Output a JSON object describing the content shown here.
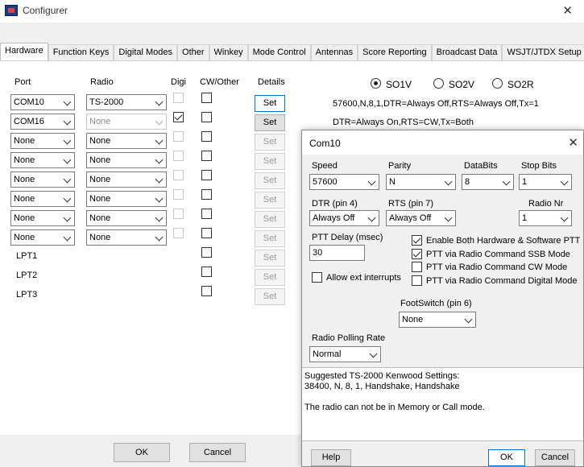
{
  "window": {
    "title": "Configurer"
  },
  "tabs": [
    "Hardware",
    "Function Keys",
    "Digital Modes",
    "Other",
    "Winkey",
    "Mode Control",
    "Antennas",
    "Score Reporting",
    "Broadcast Data",
    "WSJT/JTDX Setup"
  ],
  "headers": {
    "port": "Port",
    "radio": "Radio",
    "digi": "Digi",
    "cw": "CW/Other",
    "details": "Details"
  },
  "rows": [
    {
      "port": "COM10",
      "radio": "TS-2000",
      "radio_disabled": false,
      "digi_checked": false,
      "digi_disabled": true,
      "cw_checked": false,
      "set": "Set",
      "set_enabled": true,
      "set_focus": true
    },
    {
      "port": "COM16",
      "radio": "None",
      "radio_disabled": true,
      "digi_checked": true,
      "digi_disabled": false,
      "cw_checked": false,
      "set": "Set",
      "set_enabled": true,
      "set_focus": false
    },
    {
      "port": "None",
      "radio": "None",
      "radio_disabled": false,
      "digi_checked": false,
      "digi_disabled": true,
      "cw_checked": false,
      "set": "Set",
      "set_enabled": false,
      "set_focus": false
    },
    {
      "port": "None",
      "radio": "None",
      "radio_disabled": false,
      "digi_checked": false,
      "digi_disabled": true,
      "cw_checked": false,
      "set": "Set",
      "set_enabled": false,
      "set_focus": false
    },
    {
      "port": "None",
      "radio": "None",
      "radio_disabled": false,
      "digi_checked": false,
      "digi_disabled": true,
      "cw_checked": false,
      "set": "Set",
      "set_enabled": false,
      "set_focus": false
    },
    {
      "port": "None",
      "radio": "None",
      "radio_disabled": false,
      "digi_checked": false,
      "digi_disabled": true,
      "cw_checked": false,
      "set": "Set",
      "set_enabled": false,
      "set_focus": false
    },
    {
      "port": "None",
      "radio": "None",
      "radio_disabled": false,
      "digi_checked": false,
      "digi_disabled": true,
      "cw_checked": false,
      "set": "Set",
      "set_enabled": false,
      "set_focus": false
    },
    {
      "port": "None",
      "radio": "None",
      "radio_disabled": false,
      "digi_checked": false,
      "digi_disabled": true,
      "cw_checked": false,
      "set": "Set",
      "set_enabled": false,
      "set_focus": false
    }
  ],
  "lpt": [
    {
      "label": "LPT1",
      "set": "Set"
    },
    {
      "label": "LPT2",
      "set": "Set"
    },
    {
      "label": "LPT3",
      "set": "Set"
    }
  ],
  "so_radios": {
    "so1v": "SO1V",
    "so2v": "SO2V",
    "so2r": "SO2R",
    "selected": "SO1V"
  },
  "status_lines": [
    "57600,N,8,1,DTR=Always Off,RTS=Always Off,Tx=1",
    "DTR=Always On,RTS=CW,Tx=Both"
  ],
  "buttons": {
    "ok": "OK",
    "cancel": "Cancel"
  },
  "dialog": {
    "title": "Com10",
    "speed": {
      "label": "Speed",
      "value": "57600"
    },
    "parity": {
      "label": "Parity",
      "value": "N"
    },
    "databits": {
      "label": "DataBits",
      "value": "8"
    },
    "stopbits": {
      "label": "Stop Bits",
      "value": "1"
    },
    "dtr": {
      "label": "DTR (pin 4)",
      "value": "Always Off"
    },
    "rts": {
      "label": "RTS (pin 7)",
      "value": "Always Off"
    },
    "radio_nr": {
      "label": "Radio Nr",
      "value": "1"
    },
    "ptt_delay": {
      "label": "PTT Delay  (msec)",
      "value": "30"
    },
    "allow_ext": {
      "label": "Allow ext interrupts",
      "checked": false
    },
    "options": [
      {
        "label": "Enable Both Hardware & Software PTT",
        "checked": true
      },
      {
        "label": "PTT via Radio Command SSB Mode",
        "checked": true
      },
      {
        "label": "PTT via Radio Command CW Mode",
        "checked": false
      },
      {
        "label": "PTT via Radio Command Digital Mode",
        "checked": false
      }
    ],
    "footswitch": {
      "label": "FootSwitch (pin 6)",
      "value": "None"
    },
    "polling": {
      "label": "Radio Polling Rate",
      "value": "Normal"
    },
    "memo": [
      "Suggested TS-2000 Kenwood Settings:",
      "38400, N, 8, 1, Handshake, Handshake",
      "",
      "The radio can not be in Memory or Call mode."
    ],
    "help": "Help",
    "ok": "OK",
    "cancel": "Cancel"
  }
}
